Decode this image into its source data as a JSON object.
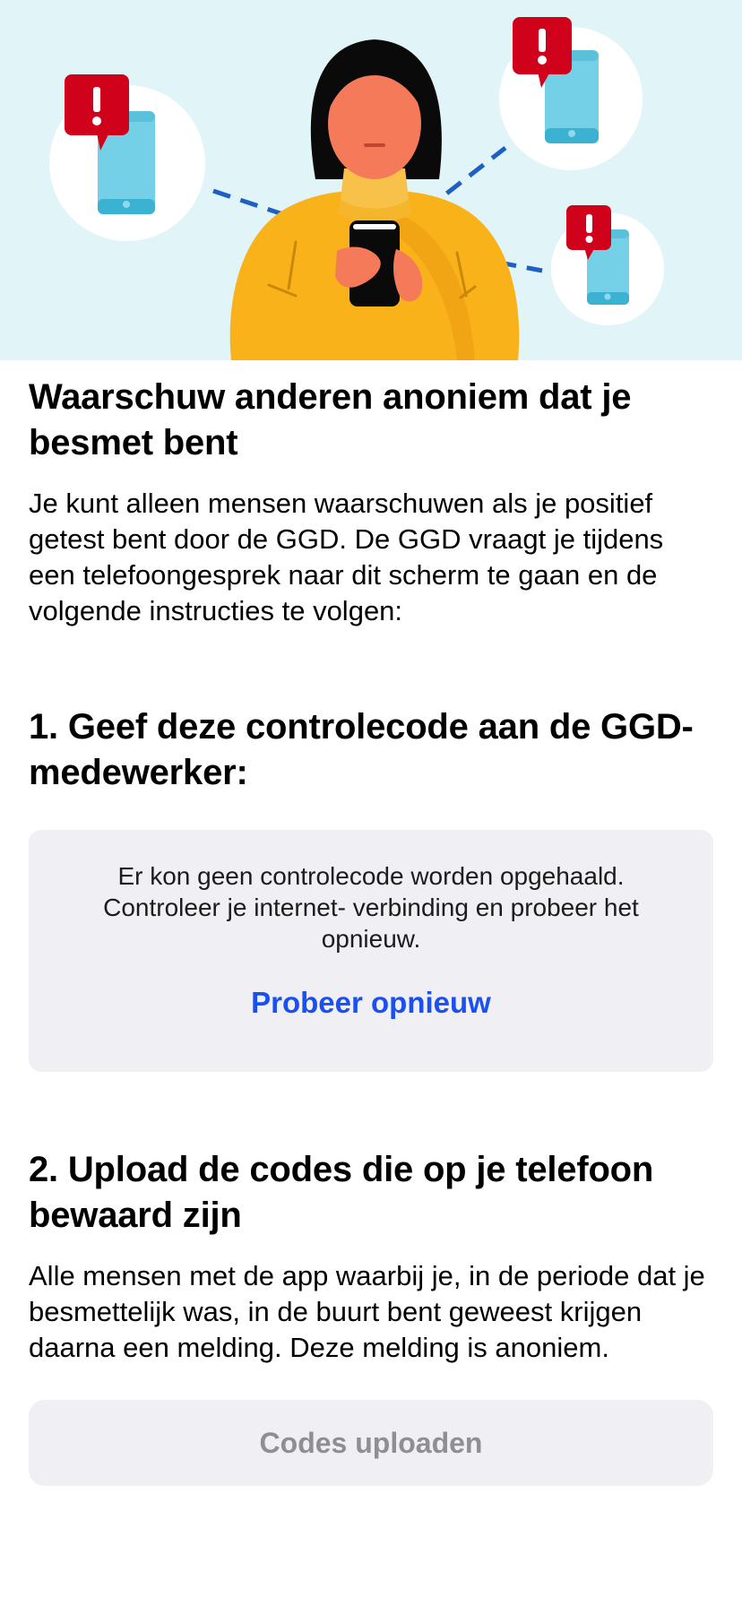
{
  "header": {
    "title": "Waarschuw anderen anoniem dat je besmet bent",
    "intro": "Je kunt alleen mensen waarschuwen als je positief getest bent door de GGD. De GGD vraagt je tijdens een telefoongesprek naar dit scherm te gaan en de volgende instructies te volgen:"
  },
  "step1": {
    "title": "1. Geef deze controlecode aan de GGD-medewerker:",
    "error_message": "Er kon geen controlecode worden opgehaald. Controleer je internet- verbinding en probeer het opnieuw.",
    "retry_label": "Probeer opnieuw"
  },
  "step2": {
    "title": "2. Upload de codes die op je telefoon bewaard zijn",
    "description": "Alle mensen met de app waarbij je, in de periode dat je besmettelijk was, in de buurt bent geweest krijgen daarna een melding. Deze melding is anoniem.",
    "upload_label": "Codes uploaden"
  },
  "illustration": {
    "icon": "person-warning-phones-illustration",
    "alert_glyph": "!"
  },
  "colors": {
    "hero_background": "#e1f5f8",
    "link_blue": "#1a4ff0",
    "box_background": "#efeff4",
    "disabled_text": "#8e8e93",
    "alert_red": "#d0021b",
    "phone_blue": "#74d0e6",
    "sweater_yellow": "#f9b21a"
  }
}
